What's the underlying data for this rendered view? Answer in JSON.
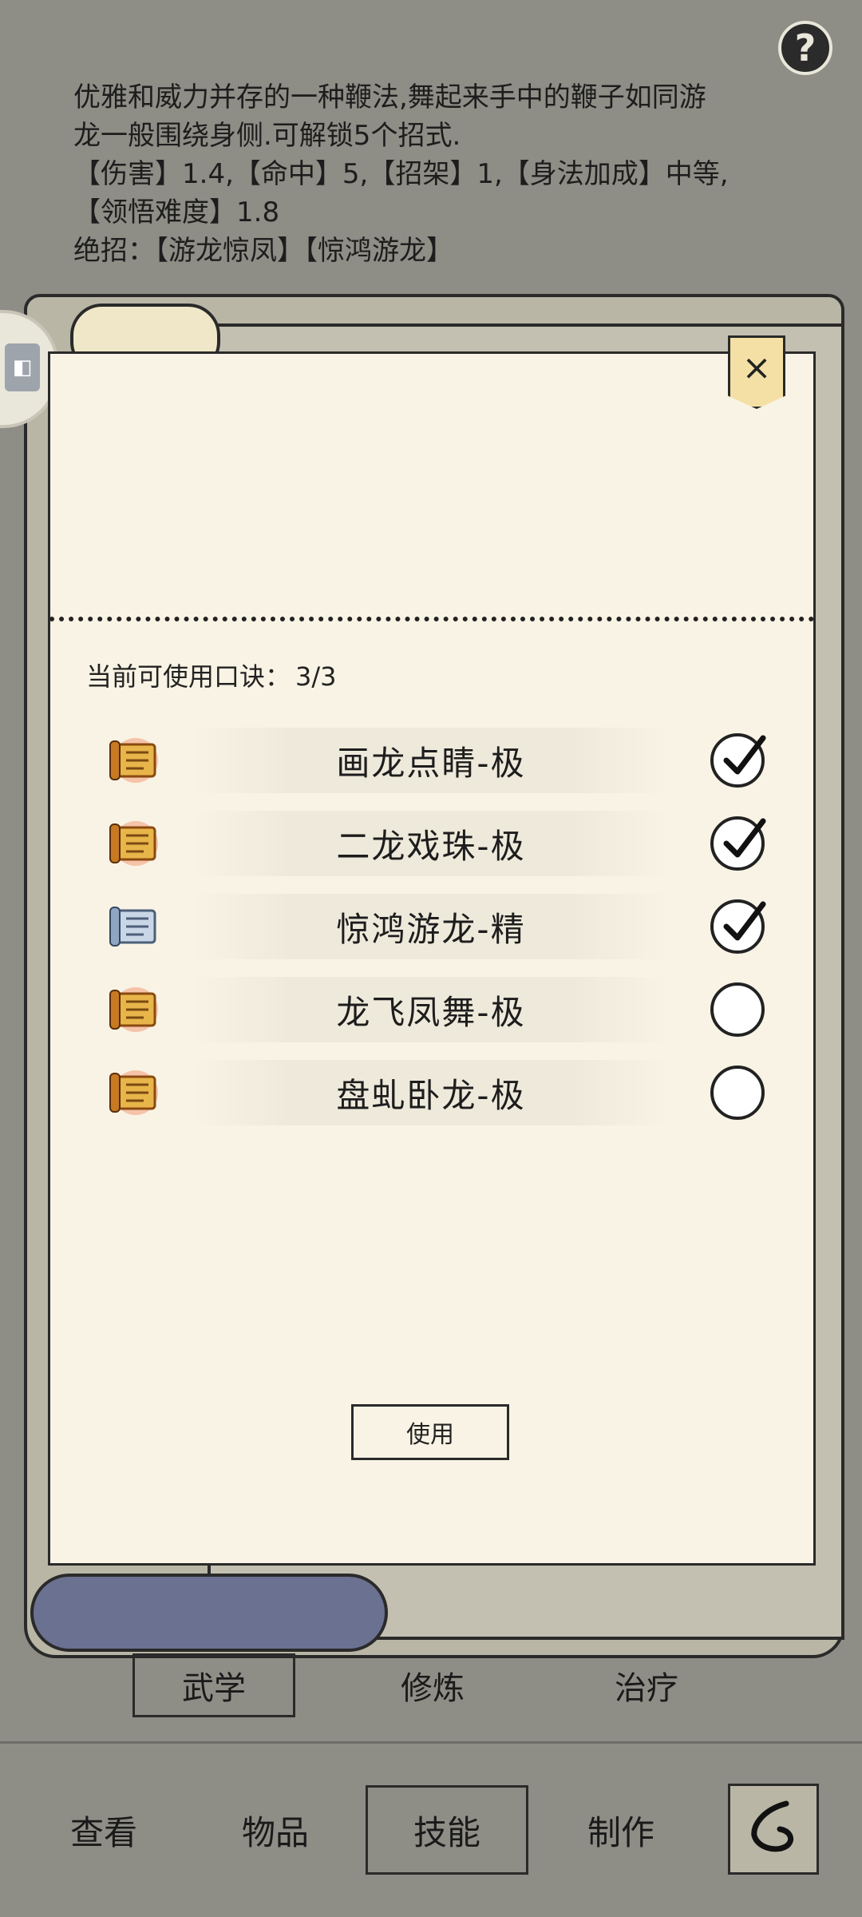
{
  "help_icon": "question-mark-icon",
  "description": {
    "line1": "优雅和威力并存的一种鞭法,舞起来手中的鞭子如同游",
    "line2": "龙一般围绕身侧.可解锁5个招式.",
    "line3": "【伤害】1.4,【命中】5,【招架】1,【身法加成】中等,",
    "line4": "【领悟难度】1.8",
    "line5": "绝招：【游龙惊凤】【惊鸿游龙】"
  },
  "popup": {
    "close_label": "×",
    "count_label": "当前可使用口诀：",
    "count_value": "3/3",
    "use_label": "使用",
    "skills": [
      {
        "name": "画龙点睛-极",
        "icon": "gold-scroll-icon",
        "checked": true
      },
      {
        "name": "二龙戏珠-极",
        "icon": "gold-scroll-icon",
        "checked": true
      },
      {
        "name": "惊鸿游龙-精",
        "icon": "blue-scroll-icon",
        "checked": true
      },
      {
        "name": "龙飞凤舞-极",
        "icon": "gold-scroll-icon",
        "checked": false
      },
      {
        "name": "盘虬卧龙-极",
        "icon": "gold-scroll-icon",
        "checked": false
      }
    ]
  },
  "subtabs": {
    "t1": "武学",
    "t2": "修炼",
    "t3": "治疗"
  },
  "nav": {
    "n1": "查看",
    "n2": "物品",
    "n3": "技能",
    "n4": "制作",
    "back_icon": "back-icon"
  },
  "colors": {
    "background": "#8e8d86",
    "paper": "#f8f3e4",
    "gold": "#e8b54a",
    "blue": "#a9bcd3"
  }
}
